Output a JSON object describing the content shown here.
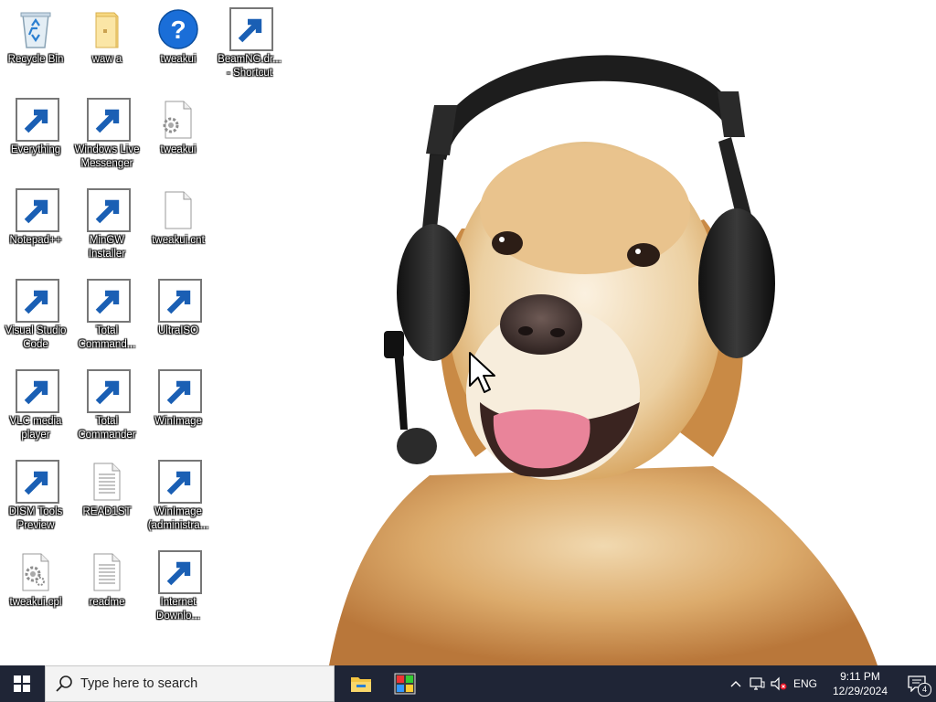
{
  "desktop": {
    "icons": [
      {
        "label": "Recycle Bin",
        "icon": "recycle-bin-icon"
      },
      {
        "label": "waw a",
        "icon": "folder-icon"
      },
      {
        "label": "tweakui",
        "icon": "help-icon"
      },
      {
        "label": "BeamNG.dr... - Shortcut",
        "icon": "beamng-icon"
      },
      {
        "label": "Everything",
        "icon": "everything-search-icon"
      },
      {
        "label": "Windows Live Messenger",
        "icon": "messenger-icon"
      },
      {
        "label": "tweakui",
        "icon": "settings-file-icon"
      },
      {
        "label": "Notepad++",
        "icon": "notepad-plus-plus-icon"
      },
      {
        "label": "MinGW Installer",
        "icon": "mingw-installer-icon"
      },
      {
        "label": "tweakui.cnt",
        "icon": "blank-file-icon"
      },
      {
        "label": "Visual Studio Code",
        "icon": "vscode-icon"
      },
      {
        "label": "Total Command...",
        "icon": "total-commander-64-icon"
      },
      {
        "label": "UltraISO",
        "icon": "ultraiso-icon"
      },
      {
        "label": "VLC media player",
        "icon": "vlc-icon"
      },
      {
        "label": "Total Commander",
        "icon": "total-commander-icon"
      },
      {
        "label": "WinImage",
        "icon": "winimage-icon"
      },
      {
        "label": "DISM Tools Preview",
        "icon": "dism-tools-icon"
      },
      {
        "label": "READ1ST",
        "icon": "text-file-icon"
      },
      {
        "label": "WinImage (administra...",
        "icon": "winimage-admin-icon"
      },
      {
        "label": "tweakui.cpl",
        "icon": "control-panel-file-icon"
      },
      {
        "label": "readme",
        "icon": "text-file-icon"
      },
      {
        "label": "Internet Downlo...",
        "icon": "idm-icon"
      }
    ]
  },
  "taskbar": {
    "start_icon": "windows-logo-icon",
    "search_placeholder": "Type here to search",
    "pinned": [
      {
        "name": "File Explorer",
        "icon": "file-explorer-icon"
      },
      {
        "name": "App",
        "icon": "colorful-app-icon"
      }
    ],
    "tray": {
      "language": "ENG",
      "time": "9:11 PM",
      "date": "12/29/2024",
      "notification_count": "4"
    }
  },
  "colors": {
    "taskbar_bg": "#1f2536",
    "search_bg": "#f3f3f3",
    "icon_label": "#ffffff"
  }
}
